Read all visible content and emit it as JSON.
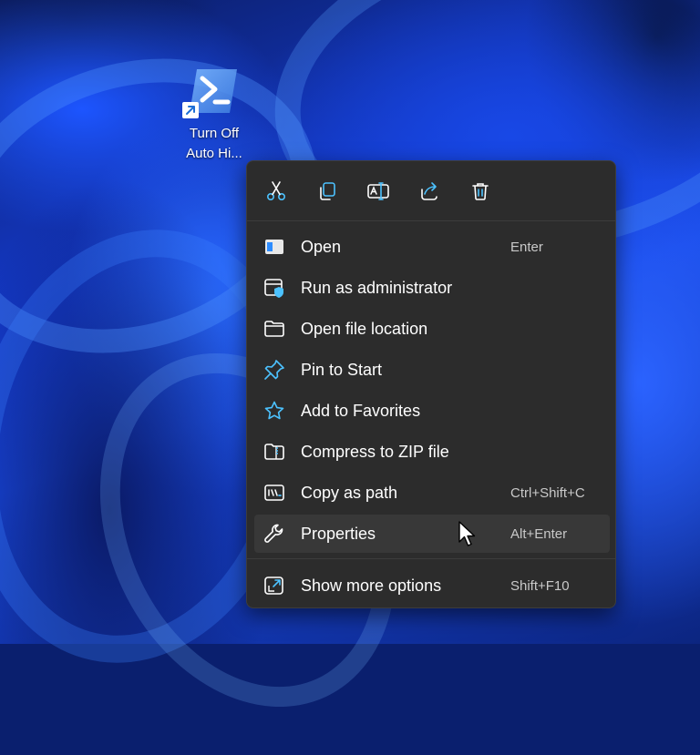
{
  "desktop": {
    "shortcut": {
      "icon": "powershell-icon",
      "overlay_icon": "shortcut-arrow-icon",
      "label": "Turn Off\nAuto Hi..."
    }
  },
  "context_menu": {
    "toolbar": [
      {
        "name": "cut",
        "icon": "scissors-icon"
      },
      {
        "name": "copy",
        "icon": "copy-icon"
      },
      {
        "name": "rename",
        "icon": "rename-icon"
      },
      {
        "name": "share",
        "icon": "share-icon"
      },
      {
        "name": "delete",
        "icon": "trash-icon"
      }
    ],
    "items": [
      {
        "label": "Open",
        "shortcut": "Enter",
        "icon": "window-icon"
      },
      {
        "label": "Run as administrator",
        "shortcut": "",
        "icon": "shield-window-icon"
      },
      {
        "label": "Open file location",
        "shortcut": "",
        "icon": "folder-icon"
      },
      {
        "label": "Pin to Start",
        "shortcut": "",
        "icon": "pin-icon"
      },
      {
        "label": "Add to Favorites",
        "shortcut": "",
        "icon": "star-icon"
      },
      {
        "label": "Compress to ZIP file",
        "shortcut": "",
        "icon": "zip-folder-icon"
      },
      {
        "label": "Copy as path",
        "shortcut": "Ctrl+Shift+C",
        "icon": "path-icon"
      },
      {
        "label": "Properties",
        "shortcut": "Alt+Enter",
        "icon": "wrench-icon"
      },
      {
        "label": "Show more options",
        "shortcut": "Shift+F10",
        "icon": "expand-icon"
      }
    ]
  },
  "colors": {
    "menu_bg": "#2c2c2c",
    "hover_bg": "#383838",
    "accent": "#4cc2ff",
    "text": "#ffffff",
    "shortcut_text": "#c9c9c9"
  }
}
